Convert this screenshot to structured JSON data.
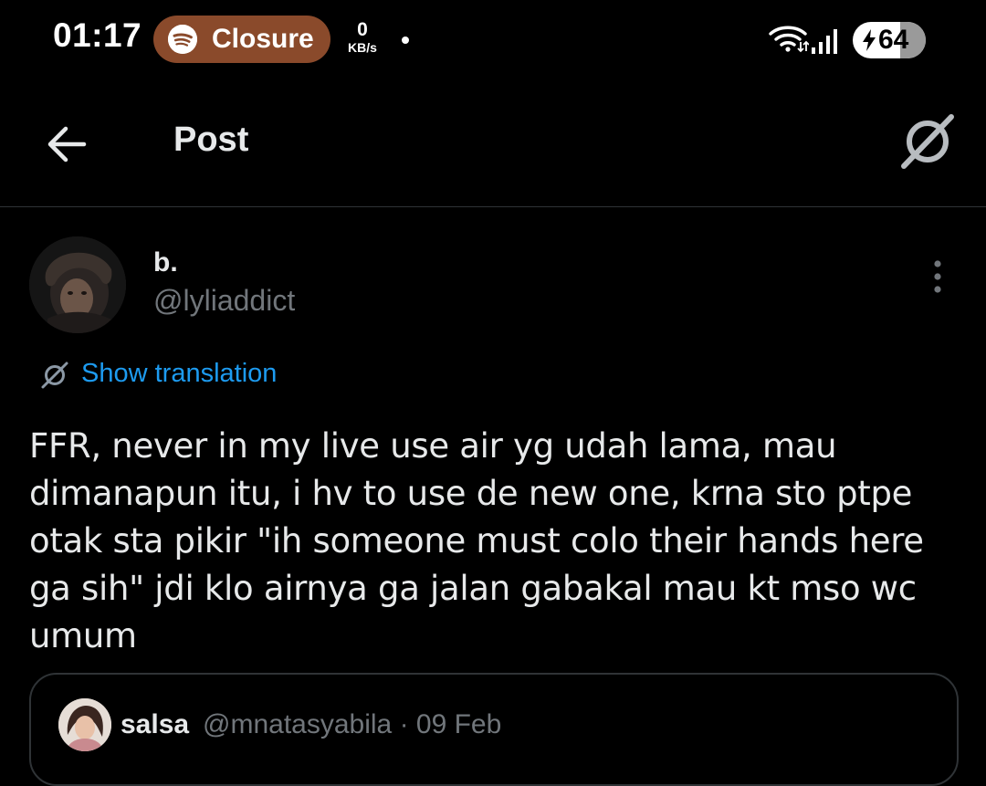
{
  "status_bar": {
    "time": "01:17",
    "now_playing_app": "Closure",
    "net_speed_value": "0",
    "net_speed_unit": "KB/s",
    "battery_level": "64",
    "battery_fraction": 0.64,
    "charging": true
  },
  "header": {
    "title": "Post",
    "back_icon": "arrow-left-icon",
    "action_icon": "grok-icon"
  },
  "post": {
    "display_name": "b.",
    "username": "@lyliaddict",
    "translate_label": "Show translation",
    "text": "FFR, never in my live use air yg udah lama, mau dimanapun itu, i hv to use de new one, krna sto ptpe otak sta pikir \"ih someone must colo their hands here ga sih\" jdi klo airnya ga jalan gabakal mau kt mso wc umum",
    "more_icon": "more-vertical-icon"
  },
  "quote": {
    "name": "salsa",
    "handle": "@mnatasyabila",
    "separator": "·",
    "date": "09 Feb"
  },
  "colors": {
    "background": "#000000",
    "text": "#e7e9ea",
    "muted": "#71767b",
    "link": "#1d9bf0",
    "pill": "#8a4a2b",
    "divider": "#2f3336"
  }
}
